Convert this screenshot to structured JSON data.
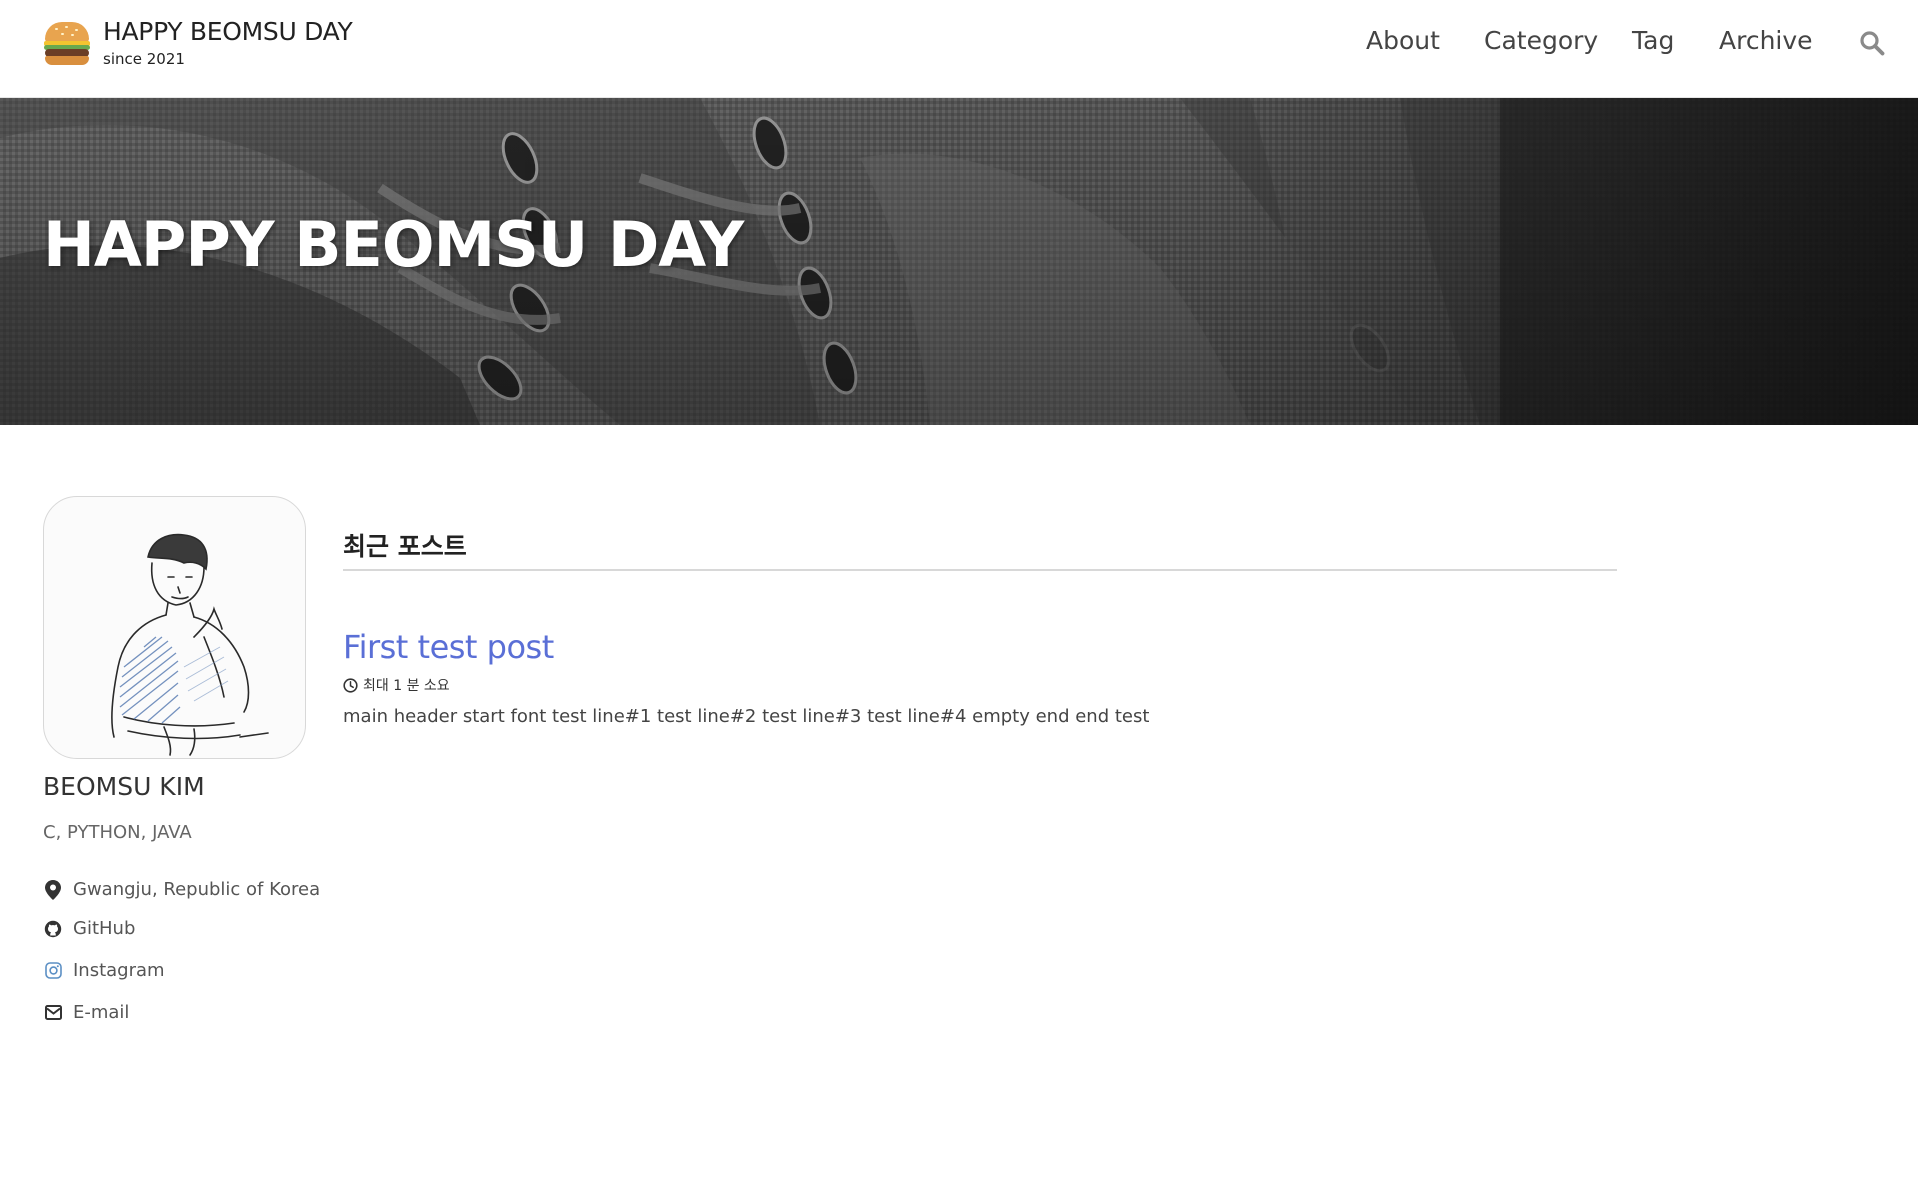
{
  "site": {
    "title": "HAPPY BEOMSU DAY",
    "since": "since 2021",
    "logo_icon": "hamburger-icon"
  },
  "nav": {
    "items": [
      {
        "label": "About"
      },
      {
        "label": "Category"
      },
      {
        "label": "Tag"
      },
      {
        "label": "Archive"
      }
    ],
    "search_icon": "search-icon"
  },
  "hero": {
    "title": "HAPPY BEOMSU DAY"
  },
  "author": {
    "name": "BEOMSU KIM",
    "bio": "C, PYTHON, JAVA",
    "links": [
      {
        "icon": "map-marker-icon",
        "label": "Gwangju, Republic of Korea"
      },
      {
        "icon": "github-icon",
        "label": "GitHub"
      },
      {
        "icon": "instagram-icon",
        "label": "Instagram"
      },
      {
        "icon": "envelope-icon",
        "label": "E-mail"
      }
    ]
  },
  "recent": {
    "heading": "최근 포스트",
    "posts": [
      {
        "title": "First test post",
        "read_time": "최대 1 분 소요",
        "excerpt": "main header start font test line#1 test line#2 test line#3 test line#4 empty end end test"
      }
    ]
  },
  "colors": {
    "link": "#5a6fd6",
    "text": "#333333",
    "rule": "#d8d8d8",
    "instagram": "#5b8fc4"
  }
}
